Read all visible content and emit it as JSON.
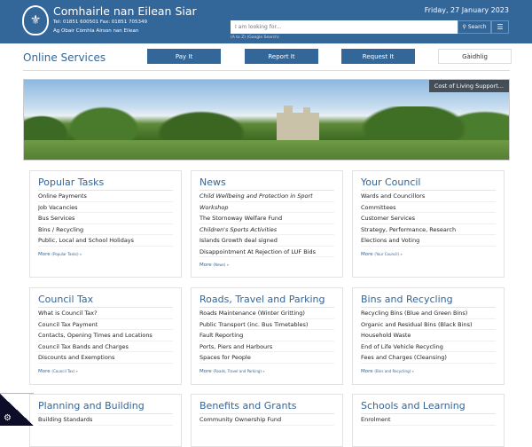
{
  "header": {
    "title": "Comhairle nan Eilean Siar",
    "tel": "Tel: 01851 600501 Fax: 01851 705349",
    "motto": "Ag Obair Còmhla Airson nan Eilean",
    "date": "Friday, 27 January 2023",
    "search_placeholder": "I am looking for...",
    "search_button": "Search",
    "links": "(A to Z) (Google Search)",
    "menu_icon": "☰"
  },
  "nav": {
    "title": "Online Services",
    "buttons": [
      "Pay It",
      "Report It",
      "Request It",
      "Gàidhlig"
    ]
  },
  "banner": {
    "caption": "Cost of Living Support..."
  },
  "cards": [
    {
      "title": "Popular Tasks",
      "items": [
        "Online Payments",
        "Job Vacancies",
        "Bus Services",
        "Bins / Recycling",
        "Public, Local and School Holidays"
      ],
      "more": "More",
      "more_sub": "(Popular Tasks) »"
    },
    {
      "title": "News",
      "items": [
        "Child Wellbeing and Protection in Sport",
        "Workshop",
        "The Stornoway Welfare Fund",
        "Children's Sports Activities",
        "Islands Growth deal signed",
        "Disappointment At Rejection of LUF Bids"
      ],
      "more": "More",
      "more_sub": "(News) »"
    },
    {
      "title": "Your Council",
      "items": [
        "Wards and Councillors",
        "Committees",
        "Customer Services",
        "Strategy, Performance, Research",
        "Elections and Voting"
      ],
      "more": "More",
      "more_sub": "(Your Council) »"
    },
    {
      "title": "Council Tax",
      "items": [
        "What is Council Tax?",
        "Council Tax Payment",
        "Contacts, Opening Times and Locations",
        "Council Tax Bands and Charges",
        "Discounts and Exemptions"
      ],
      "more": "More",
      "more_sub": "(Council Tax) »"
    },
    {
      "title": "Roads, Travel and Parking",
      "items": [
        "Roads Maintenance (Winter Gritting)",
        "Public Transport (inc. Bus Timetables)",
        "Fault Reporting",
        "Ports, Piers and Harbours",
        "Spaces for People"
      ],
      "more": "More",
      "more_sub": "(Roads, Travel and Parking) »"
    },
    {
      "title": "Bins and Recycling",
      "items": [
        "Recycling Bins (Blue and Green Bins)",
        "Organic and Residual Bins (Black Bins)",
        "Household Waste",
        "End of Life Vehicle Recycling",
        "Fees and Charges (Cleansing)"
      ],
      "more": "More",
      "more_sub": "(Bins and Recycling) »"
    },
    {
      "title": "Planning and Building",
      "items": [
        "Building Standards"
      ]
    },
    {
      "title": "Benefits and Grants",
      "items": [
        "Community Ownership Fund"
      ]
    },
    {
      "title": "Schools and Learning",
      "items": [
        "Enrolment"
      ]
    }
  ]
}
